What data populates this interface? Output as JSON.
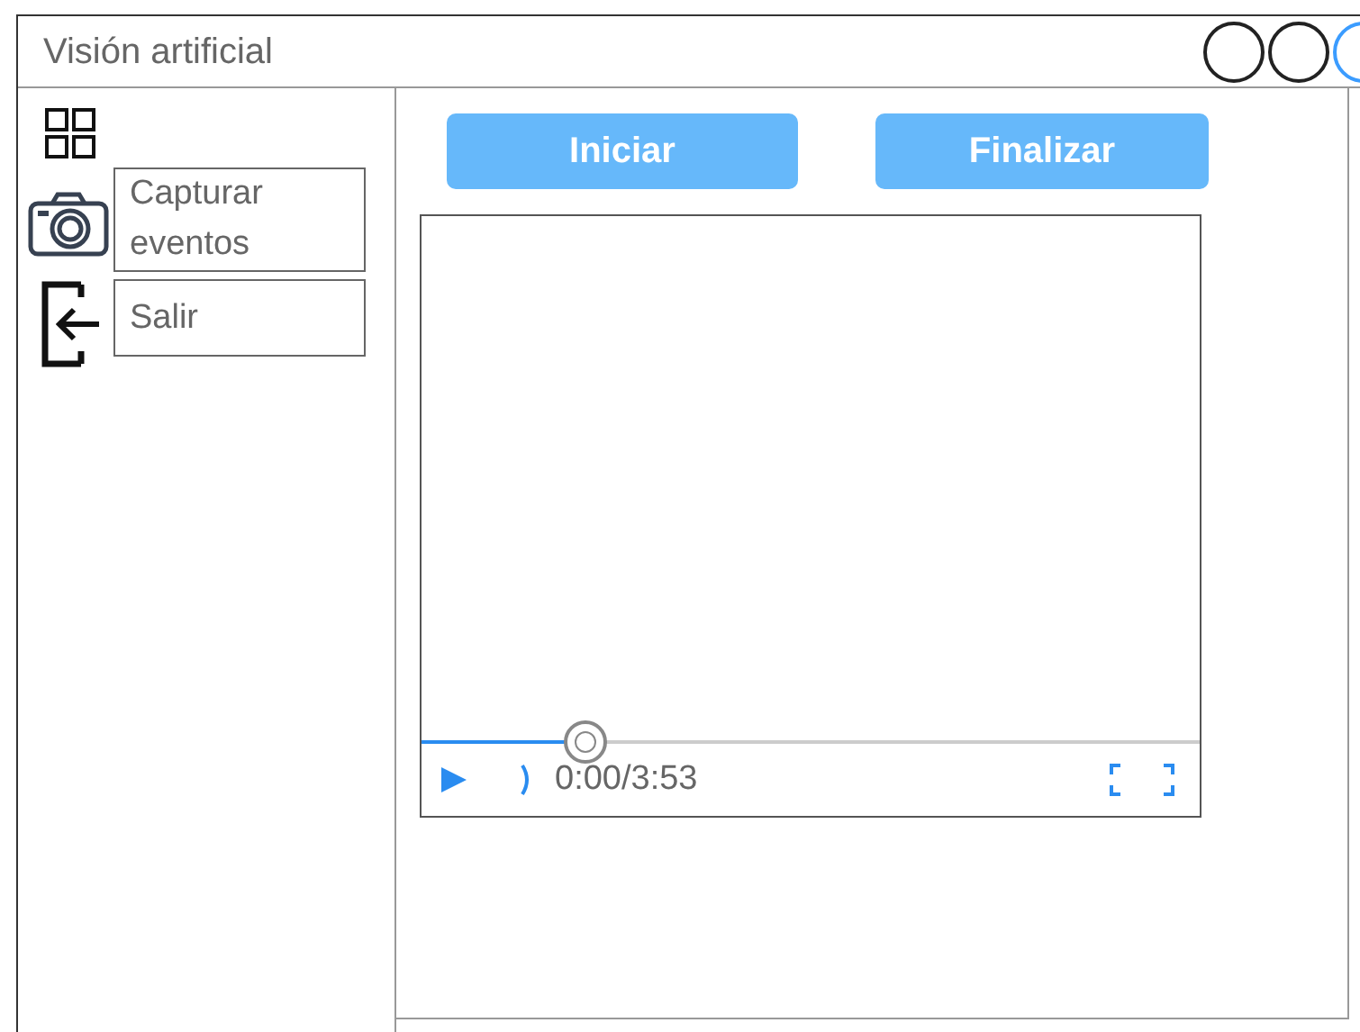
{
  "window": {
    "title": "Visión artificial"
  },
  "sidebar": {
    "items": [
      {
        "label": "Capturar eventos",
        "kind": "camera"
      },
      {
        "label": "Salir",
        "kind": "exit"
      }
    ]
  },
  "buttons": [
    {
      "label": "Iniciar"
    },
    {
      "label": "Finalizar"
    }
  ],
  "video": {
    "level": 0.21,
    "time": "0:00/3:53"
  }
}
